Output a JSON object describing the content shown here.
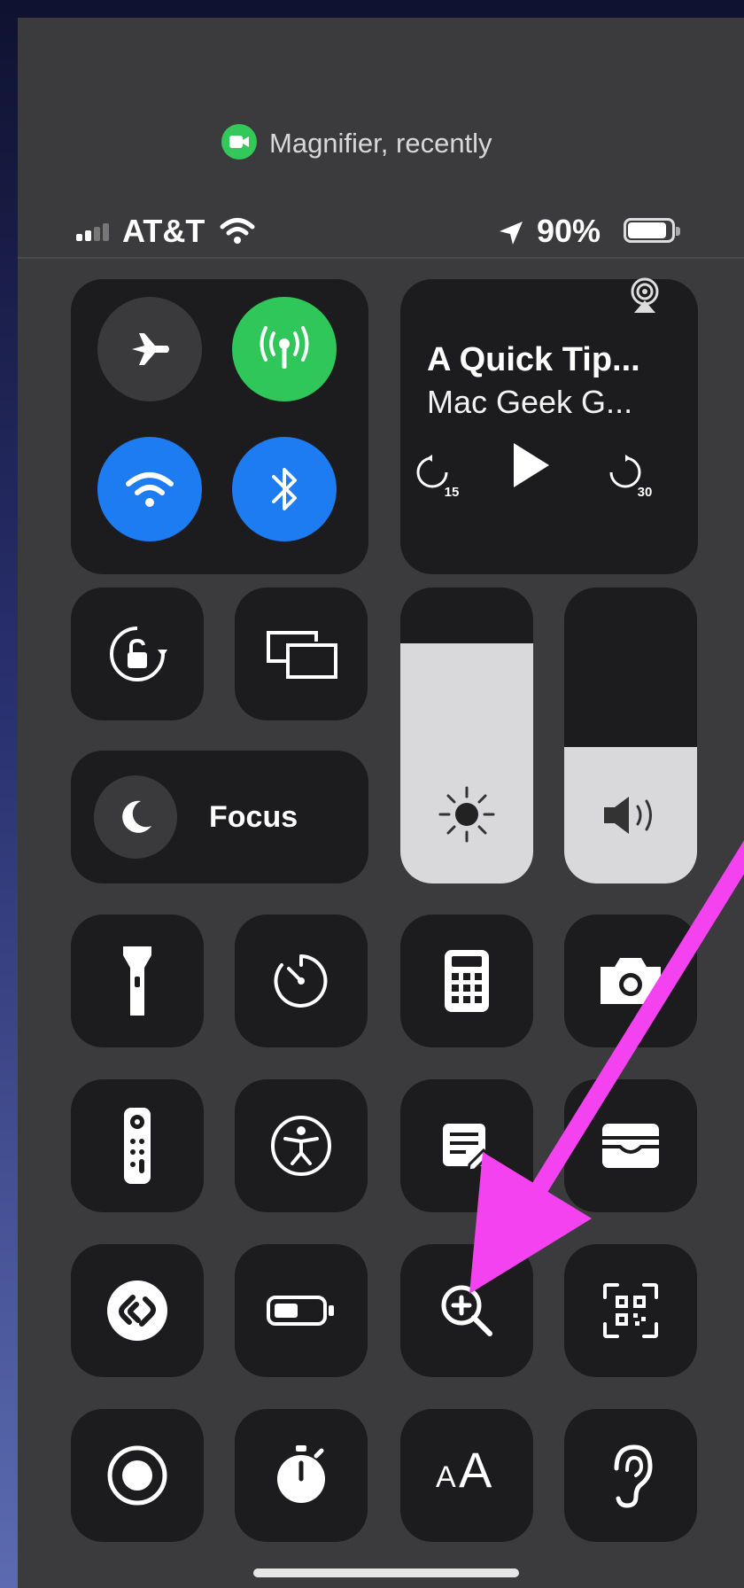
{
  "banner": {
    "app_icon": "facetime-camera-icon",
    "text": "Magnifier, recently",
    "icon_color": "#34c759"
  },
  "status_bar": {
    "carrier": "AT&T",
    "battery": "90%",
    "battery_level": 0.9,
    "icons": [
      "signal-bars-icon",
      "wifi-icon",
      "location-arrow-icon",
      "battery-icon"
    ]
  },
  "connectivity": {
    "airplane": {
      "icon": "airplane-icon",
      "on": false
    },
    "cellular": {
      "icon": "cellular-antenna-icon",
      "on": true,
      "color": "#30c75a"
    },
    "wifi": {
      "icon": "wifi-icon",
      "on": true,
      "color": "#1d7cf2"
    },
    "bluetooth": {
      "icon": "bluetooth-icon",
      "on": true,
      "color": "#1d7cf2"
    }
  },
  "now_playing": {
    "title": "A Quick Tip...",
    "subtitle": "Mac Geek G...",
    "skip_back": "15",
    "skip_forward": "30",
    "airplay_icon": "airplay-audio-icon"
  },
  "focus": {
    "label": "Focus",
    "icon": "moon-icon"
  },
  "sliders": {
    "brightness": {
      "level": 0.81,
      "icon": "sun-icon"
    },
    "volume": {
      "level": 0.46,
      "icon": "speaker-icon"
    }
  },
  "controls": [
    [
      "rotation-lock-icon",
      "screen-mirroring-icon"
    ],
    [
      "flashlight-icon",
      "timer-icon",
      "calculator-icon",
      "camera-icon"
    ],
    [
      "apple-tv-remote-icon",
      "accessibility-icon",
      "notes-icon",
      "wallet-icon"
    ],
    [
      "shazam-icon",
      "low-power-battery-icon",
      "magnifier-icon",
      "qr-code-scanner-icon"
    ],
    [
      "screen-recording-icon",
      "stopwatch-icon",
      "text-size-icon",
      "hearing-icon"
    ]
  ],
  "text_size": {
    "small": "A",
    "large": "A"
  },
  "annotation": {
    "type": "arrow",
    "color": "#f542f0",
    "points_to": "magnifier-icon"
  },
  "home_indicator": "home-indicator"
}
